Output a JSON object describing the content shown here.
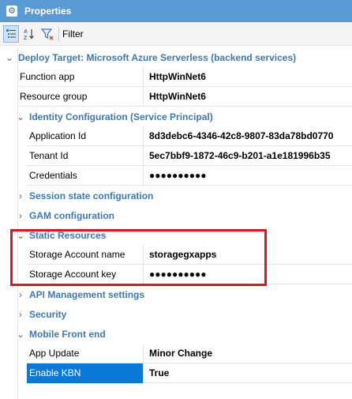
{
  "titlebar": {
    "title": "Properties",
    "icon": "gear-icon"
  },
  "toolbar": {
    "filter_label": "Filter",
    "sort_az_label": "AZ"
  },
  "colors": {
    "titlebar": "#5b9bd5",
    "category_text": "#3c79b6",
    "selection": "#0a78d7",
    "highlight_border": "#e0141e"
  },
  "deploy": {
    "label": "Deploy Target: Microsoft Azure Serverless (backend services)",
    "function_app": {
      "name": "Function app",
      "value": "HttpWinNet6"
    },
    "resource_group": {
      "name": "Resource group",
      "value": "HttpWinNet6"
    }
  },
  "identity": {
    "label": "Identity Configuration (Service Principal)",
    "application_id": {
      "name": "Application Id",
      "value": "8d3debc6-4346-42c8-9807-83da78bd0770"
    },
    "tenant_id": {
      "name": "Tenant Id",
      "value": "5ec7bbf9-1872-46c9-b201-a1e181996b35"
    },
    "credentials": {
      "name": "Credentials",
      "value": "●●●●●●●●●●"
    }
  },
  "session_state": {
    "label": "Session state configuration"
  },
  "gam": {
    "label": "GAM configuration"
  },
  "static_resources": {
    "label": "Static Resources",
    "storage_account_name": {
      "name": "Storage Account name",
      "value": "storagegxapps"
    },
    "storage_account_key": {
      "name": "Storage Account key",
      "value": "●●●●●●●●●●"
    }
  },
  "api_management": {
    "label": "API Management settings"
  },
  "security": {
    "label": "Security"
  },
  "mobile": {
    "label": "Mobile Front end",
    "app_update": {
      "name": "App Update",
      "value": "Minor Change"
    },
    "enable_kbn": {
      "name": "Enable KBN",
      "value": "True"
    }
  }
}
